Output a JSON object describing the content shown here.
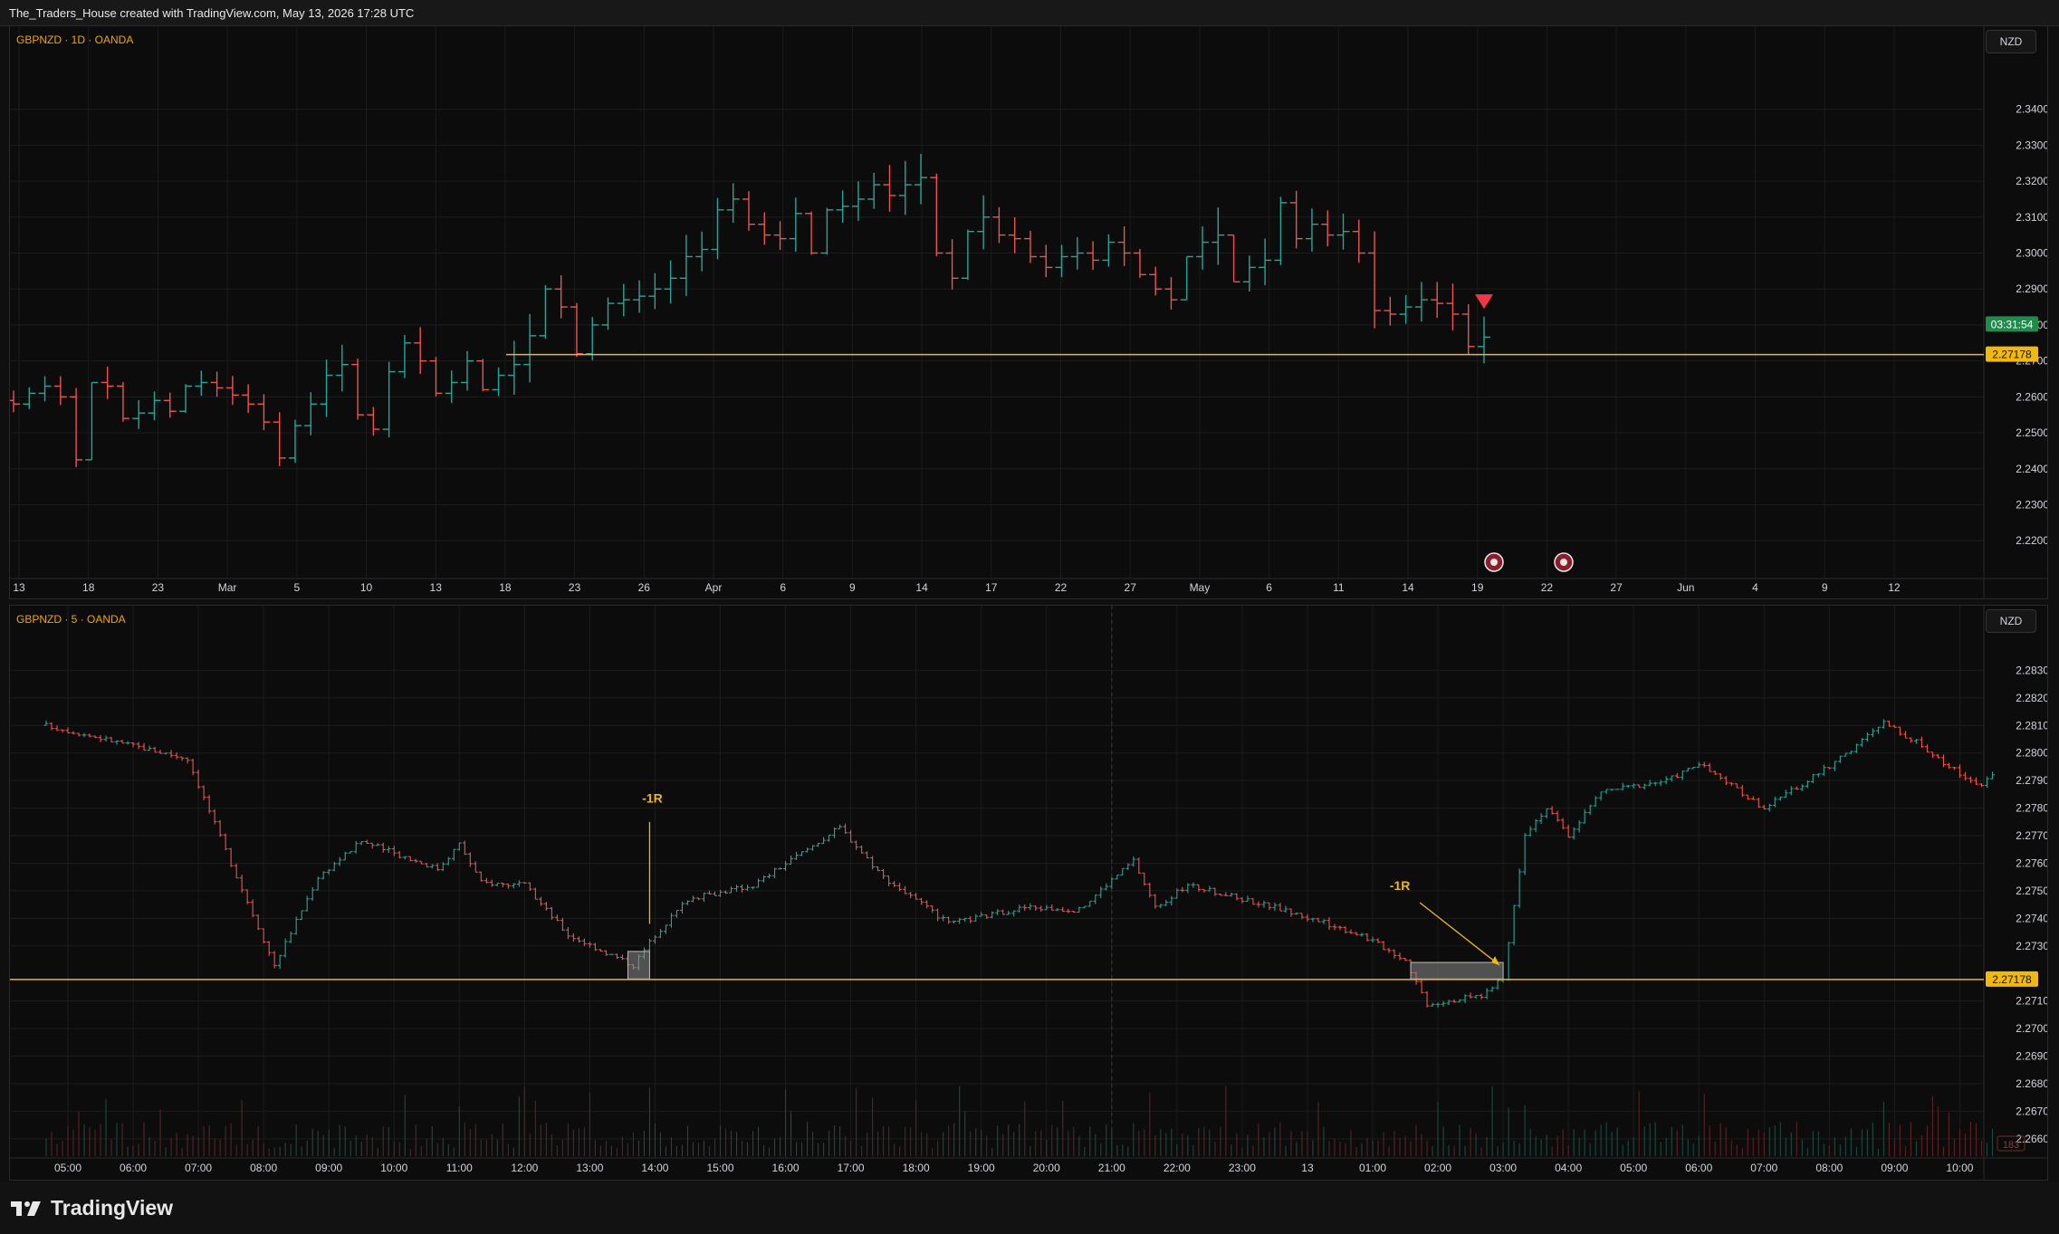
{
  "header": {
    "attribution": "The_Traders_House created with TradingView.com, May 13, 2026 17:28 UTC"
  },
  "footer": {
    "brand": "TradingView"
  },
  "colors": {
    "up": "#26a69a",
    "down": "#ef5350",
    "level": "#f0b90b",
    "grid": "#1c1c1c",
    "axis_text": "#d1d4dc"
  },
  "chart_data": [
    {
      "type": "ohlc",
      "title": "GBPNZD · 1D · OANDA",
      "currency": "NZD",
      "y_ticks": [
        "2.34000",
        "2.33000",
        "2.32000",
        "2.31000",
        "2.30000",
        "2.29000",
        "2.28000",
        "2.27000",
        "2.26000",
        "2.25000",
        "2.24000",
        "2.23000",
        "2.22000"
      ],
      "ylim": [
        2.212,
        2.353
      ],
      "x_ticks": [
        "13",
        "18",
        "23",
        "Mar",
        "5",
        "10",
        "13",
        "18",
        "23",
        "26",
        "Apr",
        "6",
        "9",
        "14",
        "17",
        "22",
        "27",
        "May",
        "6",
        "11",
        "14",
        "19",
        "22",
        "27",
        "Jun",
        "4",
        "9",
        "12"
      ],
      "level_price": 2.27178,
      "level_label": "2.27178",
      "countdown_label": "03:31:54",
      "last_price": 2.2766,
      "markers": [
        {
          "type": "down-triangle",
          "color": "#f23645",
          "near": "last bar"
        },
        {
          "type": "event-flag",
          "x_label": "14"
        },
        {
          "type": "event-flag",
          "x_label": "19"
        }
      ],
      "bar_closes": [
        2.258,
        2.261,
        2.263,
        2.26,
        2.2425,
        2.264,
        2.263,
        2.254,
        2.2555,
        2.259,
        2.256,
        2.263,
        2.264,
        2.2625,
        2.2605,
        2.258,
        2.253,
        2.243,
        2.252,
        2.258,
        2.266,
        2.269,
        2.255,
        2.251,
        2.267,
        2.275,
        2.27,
        2.261,
        2.264,
        2.27,
        2.262,
        2.266,
        2.269,
        2.277,
        2.29,
        2.285,
        2.272,
        2.28,
        2.286,
        2.287,
        2.288,
        2.29,
        2.293,
        2.299,
        2.301,
        2.312,
        2.315,
        2.308,
        2.305,
        2.304,
        2.311,
        2.3,
        2.312,
        2.313,
        2.315,
        2.319,
        2.316,
        2.319,
        2.321,
        2.3,
        2.293,
        2.306,
        2.31,
        2.305,
        2.304,
        2.299,
        2.296,
        2.299,
        2.3,
        2.298,
        2.303,
        2.3,
        2.294,
        2.29,
        2.287,
        2.299,
        2.303,
        2.305,
        2.292,
        2.296,
        2.298,
        2.314,
        2.304,
        2.308,
        2.305,
        2.306,
        2.3,
        2.284,
        2.283,
        2.285,
        2.287,
        2.286,
        2.283,
        2.274,
        2.2766
      ],
      "bar_ranges": [
        0.006,
        0.006,
        0.007,
        0.008,
        0.022,
        0.012,
        0.009,
        0.011,
        0.008,
        0.008,
        0.007,
        0.008,
        0.007,
        0.007,
        0.008,
        0.008,
        0.01,
        0.015,
        0.012,
        0.012,
        0.016,
        0.013,
        0.017,
        0.008,
        0.021,
        0.012,
        0.013,
        0.011,
        0.009,
        0.011,
        0.009,
        0.008,
        0.015,
        0.019,
        0.015,
        0.012,
        0.015,
        0.012,
        0.009,
        0.009,
        0.009,
        0.01,
        0.012,
        0.017,
        0.011,
        0.017,
        0.011,
        0.011,
        0.009,
        0.008,
        0.015,
        0.012,
        0.013,
        0.009,
        0.011,
        0.01,
        0.013,
        0.015,
        0.014,
        0.023,
        0.014,
        0.014,
        0.015,
        0.01,
        0.01,
        0.009,
        0.009,
        0.009,
        0.009,
        0.008,
        0.009,
        0.011,
        0.008,
        0.008,
        0.009,
        0.011,
        0.012,
        0.016,
        0.012,
        0.01,
        0.013,
        0.019,
        0.016,
        0.012,
        0.01,
        0.01,
        0.012,
        0.027,
        0.008,
        0.008,
        0.011,
        0.01,
        0.013,
        0.014,
        0.013
      ]
    },
    {
      "type": "ohlc",
      "title": "GBPNZD · 5 · OANDA",
      "currency": "NZD",
      "y_ticks": [
        "2.28300",
        "2.28200",
        "2.28100",
        "2.28000",
        "2.27900",
        "2.27800",
        "2.27700",
        "2.27600",
        "2.27500",
        "2.27400",
        "2.27300",
        "2.27100",
        "2.27000",
        "2.26900",
        "2.26800",
        "2.26700",
        "2.26600"
      ],
      "ylim": [
        2.2657,
        2.2839
      ],
      "x_ticks": [
        "05:00",
        "06:00",
        "07:00",
        "08:00",
        "09:00",
        "10:00",
        "11:00",
        "12:00",
        "13:00",
        "14:00",
        "15:00",
        "16:00",
        "17:00",
        "18:00",
        "19:00",
        "20:00",
        "21:00",
        "22:00",
        "23:00",
        "13",
        "01:00",
        "02:00",
        "03:00",
        "04:00",
        "05:00",
        "06:00",
        "07:00",
        "08:00",
        "09:00",
        "10:00"
      ],
      "level_price": 2.27178,
      "level_label": "2.27178",
      "volume_badge": "183",
      "annotations": [
        {
          "text": "-1R",
          "anchor_time": "13:55",
          "price": 2.2771
        },
        {
          "text": "-1R",
          "anchor_time": "02:40",
          "price": 2.2749
        }
      ],
      "zones": [
        {
          "start_time": "13:35",
          "end_time": "13:55",
          "low": 2.2718,
          "high": 2.2728
        },
        {
          "start_time": "01:35",
          "end_time": "03:00",
          "low": 2.2718,
          "high": 2.2724
        }
      ],
      "anchors": [
        {
          "time": "04:40",
          "price": 2.281
        },
        {
          "time": "06:50",
          "price": 2.2798
        },
        {
          "time": "07:30",
          "price": 2.276
        },
        {
          "time": "08:10",
          "price": 2.2723
        },
        {
          "time": "08:50",
          "price": 2.2755
        },
        {
          "time": "09:30",
          "price": 2.2768
        },
        {
          "time": "10:40",
          "price": 2.2758
        },
        {
          "time": "11:00",
          "price": 2.2767
        },
        {
          "time": "11:20",
          "price": 2.2753
        },
        {
          "time": "12:00",
          "price": 2.2752
        },
        {
          "time": "12:40",
          "price": 2.2734
        },
        {
          "time": "13:40",
          "price": 2.2723
        },
        {
          "time": "14:00",
          "price": 2.2734
        },
        {
          "time": "14:30",
          "price": 2.2747
        },
        {
          "time": "15:30",
          "price": 2.2752
        },
        {
          "time": "16:50",
          "price": 2.2773
        },
        {
          "time": "17:30",
          "price": 2.2755
        },
        {
          "time": "18:30",
          "price": 2.2738
        },
        {
          "time": "19:40",
          "price": 2.2744
        },
        {
          "time": "20:30",
          "price": 2.2743
        },
        {
          "time": "21:00",
          "price": 2.2754
        },
        {
          "time": "21:20",
          "price": 2.2761
        },
        {
          "time": "21:40",
          "price": 2.2744
        },
        {
          "time": "22:10",
          "price": 2.2752
        },
        {
          "time": "23:30",
          "price": 2.2744
        },
        {
          "time": "00:50",
          "price": 2.2734
        },
        {
          "time": "01:30",
          "price": 2.2725
        },
        {
          "time": "01:50",
          "price": 2.2709
        },
        {
          "time": "02:40",
          "price": 2.2712
        },
        {
          "time": "03:00",
          "price": 2.2718
        },
        {
          "time": "03:20",
          "price": 2.2771
        },
        {
          "time": "03:40",
          "price": 2.278
        },
        {
          "time": "04:00",
          "price": 2.277
        },
        {
          "time": "04:30",
          "price": 2.2786
        },
        {
          "time": "05:30",
          "price": 2.279
        },
        {
          "time": "06:00",
          "price": 2.2796
        },
        {
          "time": "07:00",
          "price": 2.278
        },
        {
          "time": "07:40",
          "price": 2.279
        },
        {
          "time": "08:10",
          "price": 2.2798
        },
        {
          "time": "08:50",
          "price": 2.2811
        },
        {
          "time": "09:20",
          "price": 2.2804
        },
        {
          "time": "09:50",
          "price": 2.2795
        },
        {
          "time": "10:20",
          "price": 2.2788
        },
        {
          "time": "10:30",
          "price": 2.2792
        }
      ]
    }
  ]
}
